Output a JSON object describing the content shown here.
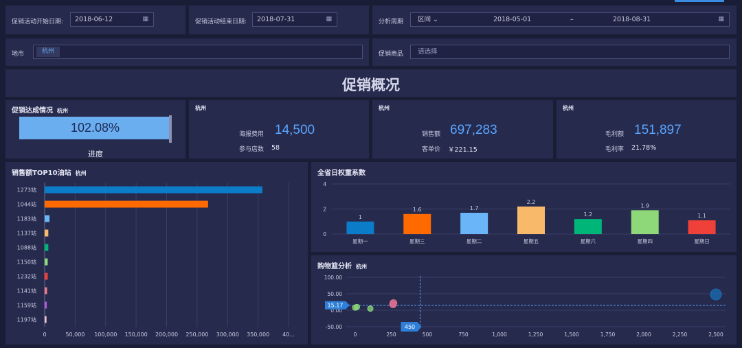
{
  "filters": {
    "start_label": "促销活动开始日期:",
    "start_value": "2018-06-12",
    "end_label": "促销活动结束日期:",
    "end_value": "2018-07-31",
    "period_label": "分析周期",
    "period_mode": "区间",
    "period_from": "2018-05-01",
    "period_sep": "–",
    "period_to": "2018-08-31",
    "city_label": "地市",
    "city_tag": "杭州",
    "product_label": "促销商品",
    "product_placeholder": "请选择"
  },
  "banner": {
    "title": "促销概况"
  },
  "kpi": {
    "achievement": {
      "title": "促销达成情况",
      "city": "杭州",
      "percent_text": "102.08%",
      "progress_label": "进度",
      "progress_value": 1.0208
    },
    "poster": {
      "city": "杭州",
      "label1": "海报费用",
      "value1": "14,500",
      "label2": "参与店数",
      "value2": "58"
    },
    "sales": {
      "city": "杭州",
      "label1": "销售额",
      "value1": "697,283",
      "label2": "客单价",
      "value2": "￥221.15"
    },
    "profit": {
      "city": "杭州",
      "label1": "毛利额",
      "value1": "151,897",
      "label2": "毛利率",
      "value2": "21.78%"
    }
  },
  "colors": {
    "accent": "#5aa5ff",
    "panel": "#262a4d",
    "background": "#1a1d36"
  },
  "chart_data": [
    {
      "type": "bar",
      "orientation": "horizontal",
      "title": "销售额TOP10油站",
      "subtitle": "杭州",
      "categories": [
        "1273站",
        "1044站",
        "1183站",
        "1137站",
        "1088站",
        "1150站",
        "1232站",
        "1141站",
        "1159站",
        "1197站"
      ],
      "values": [
        357000,
        268000,
        8000,
        6000,
        6000,
        5000,
        5000,
        4000,
        3500,
        3000
      ],
      "colors": [
        "#0a7cc8",
        "#ff6a00",
        "#6ab4f8",
        "#f8b96a",
        "#00b578",
        "#8ed87a",
        "#f0403a",
        "#f07b8a",
        "#b05ad8",
        "#f2c6d8"
      ],
      "xticks": [
        "0",
        "50,000",
        "100,000",
        "150,000",
        "200,000",
        "250,000",
        "300,000",
        "350,000",
        "40..."
      ],
      "xlim": [
        0,
        400000
      ],
      "grid": true
    },
    {
      "type": "bar",
      "title": "全省日权重系数",
      "categories": [
        "星期一",
        "星期三",
        "星期二",
        "星期五",
        "星期六",
        "星期四",
        "星期日"
      ],
      "values": [
        1,
        1.6,
        1.7,
        2.2,
        1.2,
        1.9,
        1.1
      ],
      "colors": [
        "#0a7cc8",
        "#ff6a00",
        "#6ab4f8",
        "#f8b96a",
        "#00b578",
        "#8ed87a",
        "#f0403a"
      ],
      "yticks": [
        "0",
        "2",
        "4"
      ],
      "ylim": [
        0,
        4
      ],
      "grid": true
    },
    {
      "type": "scatter",
      "title": "购物篮分析",
      "subtitle": "杭州",
      "xticks": [
        "0",
        "250",
        "500",
        "750",
        "1,000",
        "1,250",
        "1,500",
        "1,750",
        "2,000",
        "2,250",
        "2,500"
      ],
      "yticks": [
        "100.00",
        "50.00",
        "0.00",
        "-50.00"
      ],
      "xlim": [
        0,
        2500
      ],
      "ylim": [
        -50,
        100
      ],
      "points": [
        {
          "x": 0,
          "y": 8,
          "size": 4,
          "color": "#8ed87a"
        },
        {
          "x": 12,
          "y": 10,
          "size": 4,
          "color": "#8ed87a"
        },
        {
          "x": 105,
          "y": 5,
          "size": 4,
          "color": "#8ed87a"
        },
        {
          "x": 262,
          "y": 18,
          "size": 5,
          "color": "#e07090"
        },
        {
          "x": 265,
          "y": 22,
          "size": 5,
          "color": "#e07090"
        },
        {
          "x": 2500,
          "y": 48,
          "size": 8,
          "color": "#1a6eb5"
        }
      ],
      "mean_y_label": "15.17",
      "mean_y": 15.17,
      "mean_x_label": "450",
      "mean_x": 450
    }
  ]
}
